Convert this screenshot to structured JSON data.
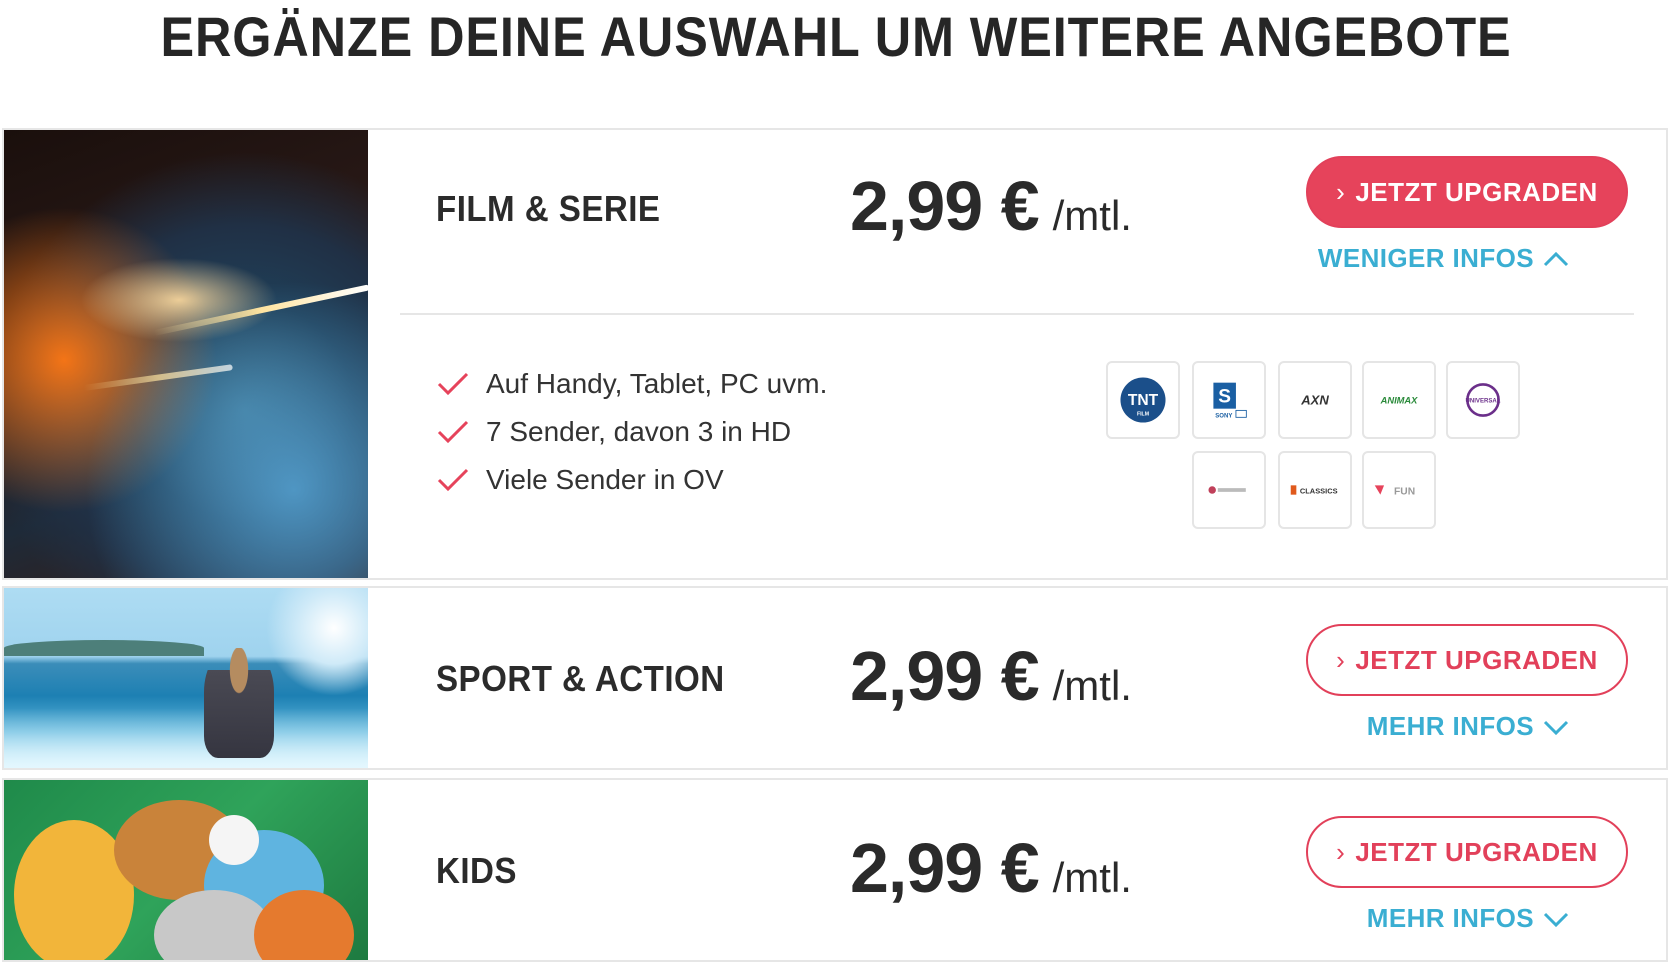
{
  "page": {
    "title": "ERGÄNZE DEINE AUSWAHL UM WEITERE ANGEBOTE"
  },
  "offers": [
    {
      "name": "FILM & SERIE",
      "price": "2,99 €",
      "period": "/mtl.",
      "button_label": "JETZT UPGRADEN",
      "info_label": "WENIGER INFOS",
      "expanded": true,
      "features": [
        "Auf Handy, Tablet, PC uvm.",
        "7 Sender, davon 3 in HD",
        "Viele Sender in OV"
      ],
      "channels": [
        "TNT FILM",
        "SONY HD",
        "AXN HD",
        "ANIMAX",
        "UNIVERSAL HD",
        "Channel",
        "FJ CLASSICS",
        "FUN"
      ]
    },
    {
      "name": "SPORT & ACTION",
      "price": "2,99 €",
      "period": "/mtl.",
      "button_label": "JETZT UPGRADEN",
      "info_label": "MEHR INFOS",
      "expanded": false
    },
    {
      "name": "KIDS",
      "price": "2,99 €",
      "period": "/mtl.",
      "button_label": "JETZT UPGRADEN",
      "info_label": "MEHR INFOS",
      "expanded": false
    }
  ],
  "colors": {
    "accent_red": "#e6435b",
    "link_blue": "#3aaed2",
    "border_gray": "#e6e6e6",
    "text_dark": "#2b2b2b"
  }
}
